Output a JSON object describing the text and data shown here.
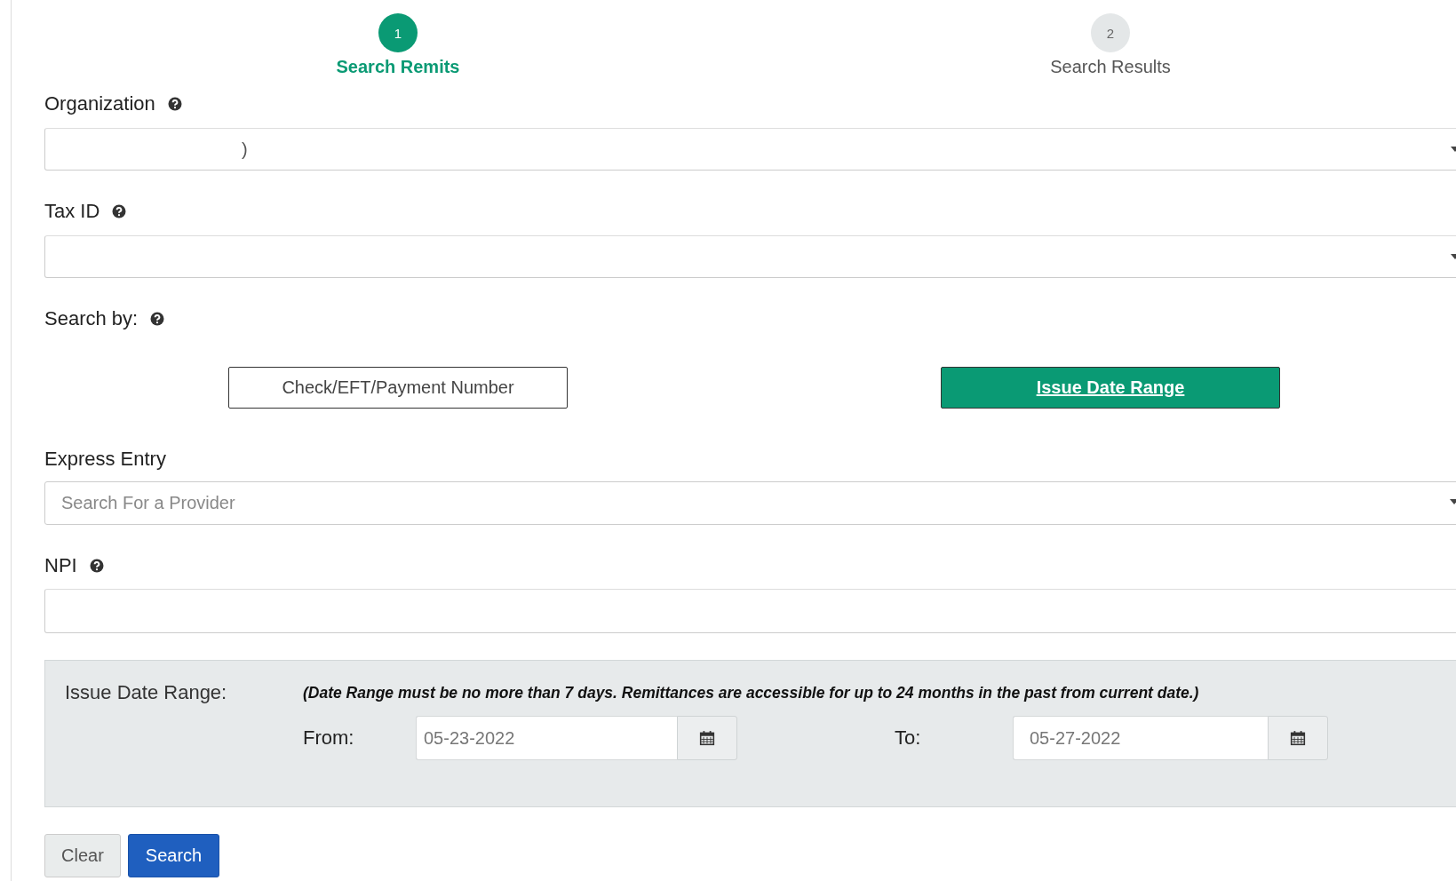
{
  "steps": [
    {
      "number": "1",
      "label": "Search Remits",
      "selected": true
    },
    {
      "number": "2",
      "label": "Search Results",
      "selected": false
    }
  ],
  "organization": {
    "label": "Organization",
    "value": ")"
  },
  "tax_id": {
    "label": "Tax ID"
  },
  "search_by": {
    "label": "Search by:",
    "options": [
      {
        "label": "Check/EFT/Payment Number",
        "selected": false
      },
      {
        "label": "Issue Date Range",
        "selected": true
      }
    ]
  },
  "express_entry": {
    "label": "Express Entry",
    "placeholder": "Search For a Provider"
  },
  "npi": {
    "label": "NPI"
  },
  "issue_date_range": {
    "label": "Issue Date Range:",
    "note": "(Date Range must be no more than 7 days. Remittances are accessible for up to 24 months in the past from current date.)",
    "from": {
      "label": "From:",
      "value": "05-23-2022"
    },
    "to": {
      "label": "To:",
      "value": "05-27-2022"
    }
  },
  "buttons": [
    {
      "label": "Clear",
      "kind": "secondary"
    },
    {
      "label": "Search",
      "kind": "primary"
    }
  ]
}
